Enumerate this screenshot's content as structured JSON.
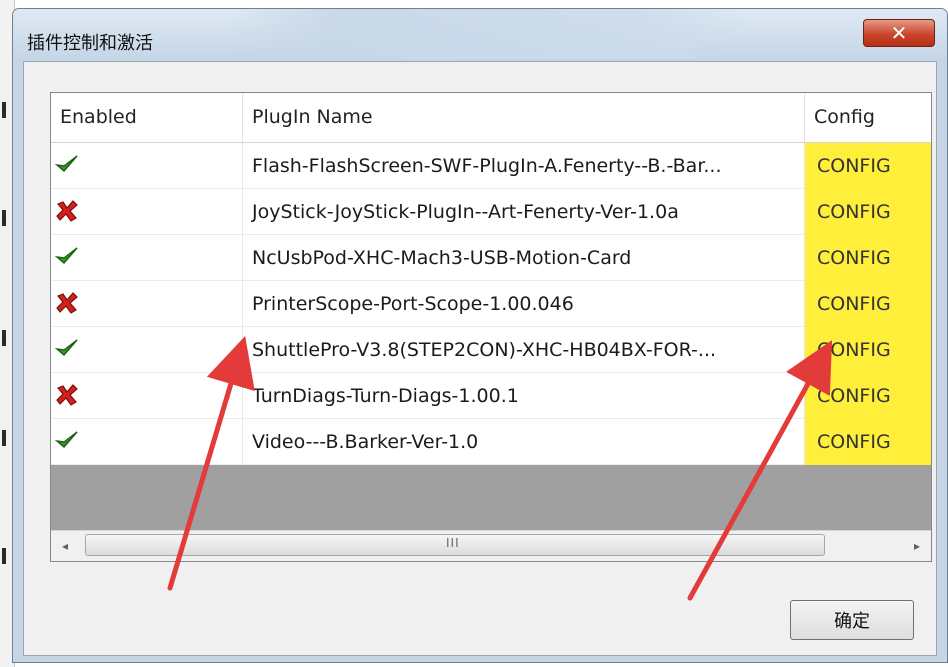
{
  "dialog": {
    "title": "插件控制和激活",
    "close_glyph": "✕",
    "ok_label": "确定"
  },
  "list": {
    "columns": [
      "Enabled",
      "PlugIn Name",
      "Config"
    ],
    "rows": [
      {
        "enabled": true,
        "name": "Flash-FlashScreen-SWF-PlugIn-A.Fenerty--B.-Bar...",
        "config": "CONFIG"
      },
      {
        "enabled": false,
        "name": "JoyStick-JoyStick-PlugIn--Art-Fenerty-Ver-1.0a",
        "config": "CONFIG"
      },
      {
        "enabled": true,
        "name": "NcUsbPod-XHC-Mach3-USB-Motion-Card",
        "config": "CONFIG"
      },
      {
        "enabled": false,
        "name": "PrinterScope-Port-Scope-1.00.046",
        "config": "CONFIG"
      },
      {
        "enabled": true,
        "name": "ShuttlePro-V3.8(STEP2CON)-XHC-HB04BX-FOR-...",
        "config": "CONFIG"
      },
      {
        "enabled": false,
        "name": "TurnDiags-Turn-Diags-1.00.1",
        "config": "CONFIG"
      },
      {
        "enabled": true,
        "name": "Video---B.Barker-Ver-1.0",
        "config": "CONFIG"
      }
    ],
    "scroll_left_glyph": "◂",
    "scroll_right_glyph": "▸",
    "scroll_grip": "III"
  },
  "icons": {
    "enabled": "green-check-icon",
    "disabled": "red-x-icon"
  },
  "colors": {
    "config_highlight": "#ffef3a",
    "check_green": "#3a9a2a",
    "x_red": "#d2201a",
    "arrow_red": "#e33a3a"
  }
}
